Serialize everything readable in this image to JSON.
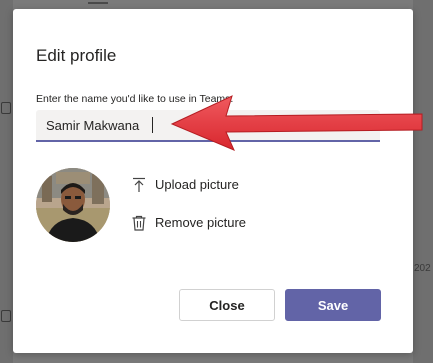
{
  "dialog": {
    "title": "Edit profile",
    "name_label": "Enter the name you'd like to use in Teams.",
    "name_value": "Samir Makwana",
    "upload_label": "Upload picture",
    "remove_label": "Remove picture",
    "close_label": "Close",
    "save_label": "Save"
  },
  "background": {
    "right_fragment": "202"
  },
  "icons": {
    "upload": "upload-arrow-icon",
    "remove": "trash-icon",
    "annotation": "red-arrow-annotation"
  },
  "colors": {
    "accent": "#6264a7",
    "annotation_arrow": "#e8333a",
    "dialog_bg": "#ffffff",
    "overlay": "#7a7a7a"
  }
}
